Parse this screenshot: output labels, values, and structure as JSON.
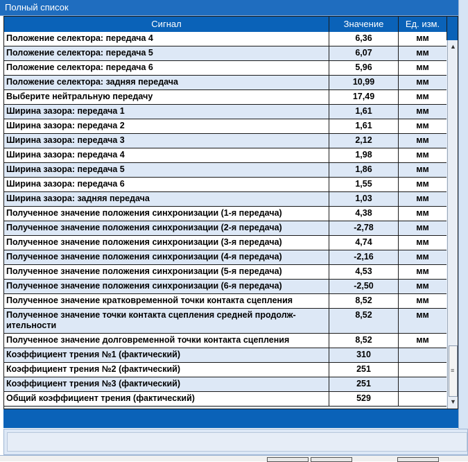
{
  "window": {
    "title": "Полный список"
  },
  "table": {
    "headers": {
      "signal": "Сигнал",
      "value": "Значение",
      "unit": "Ед. изм."
    },
    "rows": [
      {
        "signal": "Положение селектора: передача 4",
        "value": "6,36",
        "unit": "мм"
      },
      {
        "signal": "Положение селектора: передача 5",
        "value": "6,07",
        "unit": "мм"
      },
      {
        "signal": "Положение селектора: передача 6",
        "value": "5,96",
        "unit": "мм"
      },
      {
        "signal": "Положение селектора: задняя передача",
        "value": "10,99",
        "unit": "мм"
      },
      {
        "signal": "Выберите нейтральную передачу",
        "value": "17,49",
        "unit": "мм"
      },
      {
        "signal": "Ширина зазора: передача 1",
        "value": "1,61",
        "unit": "мм"
      },
      {
        "signal": "Ширина зазора: передача 2",
        "value": "1,61",
        "unit": "мм"
      },
      {
        "signal": "Ширина зазора: передача 3",
        "value": "2,12",
        "unit": "мм"
      },
      {
        "signal": "Ширина зазора: передача 4",
        "value": "1,98",
        "unit": "мм"
      },
      {
        "signal": "Ширина зазора: передача 5",
        "value": "1,86",
        "unit": "мм"
      },
      {
        "signal": "Ширина зазора: передача 6",
        "value": "1,55",
        "unit": "мм"
      },
      {
        "signal": "Ширина зазора: задняя передача",
        "value": "1,03",
        "unit": "мм"
      },
      {
        "signal": "Полученное значение положения синхронизации (1-я передача)",
        "value": "4,38",
        "unit": "мм"
      },
      {
        "signal": "Полученное значение положения синхронизации (2-я передача)",
        "value": "-2,78",
        "unit": "мм"
      },
      {
        "signal": "Полученное значение положения синхронизации (3-я передача)",
        "value": "4,74",
        "unit": "мм"
      },
      {
        "signal": "Полученное значение положения синхронизации (4-я передача)",
        "value": "-2,16",
        "unit": "мм"
      },
      {
        "signal": "Полученное значение положения синхронизации (5-я передача)",
        "value": "4,53",
        "unit": "мм"
      },
      {
        "signal": "Полученное значение положения синхронизации (6-я передача)",
        "value": "-2,50",
        "unit": "мм"
      },
      {
        "signal": "Полученное значение кратковременной точки контакта сцепления",
        "value": "8,52",
        "unit": "мм"
      },
      {
        "signal": "Полученное значение точки контакта сцепления средней продолж-ительности",
        "value": "8,52",
        "unit": "мм"
      },
      {
        "signal": "Полученное значение долговременной точки контакта сцепления",
        "value": "8,52",
        "unit": "мм"
      },
      {
        "signal": "Коэффициент трения №1 (фактический)",
        "value": "310",
        "unit": ""
      },
      {
        "signal": "Коэффициент трения №2 (фактический)",
        "value": "251",
        "unit": ""
      },
      {
        "signal": "Коэффициент трения №3 (фактический)",
        "value": "251",
        "unit": ""
      },
      {
        "signal": "Общий коэффициент трения (фактический)",
        "value": "529",
        "unit": ""
      }
    ]
  },
  "scrollbar": {
    "up_arrow": "▲",
    "down_arrow": "▼",
    "grip": "≡"
  }
}
